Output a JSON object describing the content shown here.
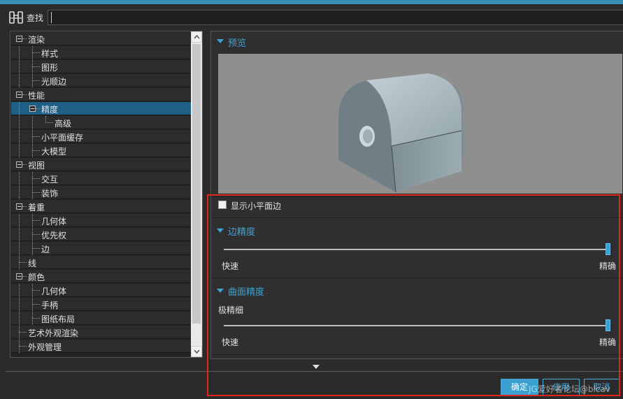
{
  "search": {
    "label": "查找",
    "value": ""
  },
  "tree": {
    "items": [
      {
        "label": "渲染"
      },
      {
        "label": "样式"
      },
      {
        "label": "图形"
      },
      {
        "label": "光顺边"
      },
      {
        "label": "性能"
      },
      {
        "label": "精度"
      },
      {
        "label": "高级"
      },
      {
        "label": "小平面缓存"
      },
      {
        "label": "大模型"
      },
      {
        "label": "视图"
      },
      {
        "label": "交互"
      },
      {
        "label": "装饰"
      },
      {
        "label": "着重"
      },
      {
        "label": "几何体"
      },
      {
        "label": "优先权"
      },
      {
        "label": "边"
      },
      {
        "label": "线"
      },
      {
        "label": "颜色"
      },
      {
        "label": "几何体"
      },
      {
        "label": "手柄"
      },
      {
        "label": "图纸布局"
      },
      {
        "label": "艺术外观渲染"
      },
      {
        "label": "外观管理"
      }
    ],
    "selected": "精度"
  },
  "preview": {
    "title": "预览"
  },
  "show_facet_edges": {
    "label": "显示小平面边",
    "checked": false
  },
  "edge_precision": {
    "title": "边精度",
    "min_label": "快速",
    "max_label": "精确",
    "value": 1.0
  },
  "surface_precision": {
    "title": "曲面精度",
    "current_label": "极精细",
    "min_label": "快速",
    "max_label": "精确",
    "value": 1.0
  },
  "buttons": {
    "ok": "确定",
    "apply": "应用",
    "cancel": "取消"
  },
  "watermark": "JG爱好者论坛@blcav",
  "colors": {
    "accent": "#3aa0d0",
    "selected_row": "#1f5f86",
    "highlight_box": "#e0261c"
  }
}
